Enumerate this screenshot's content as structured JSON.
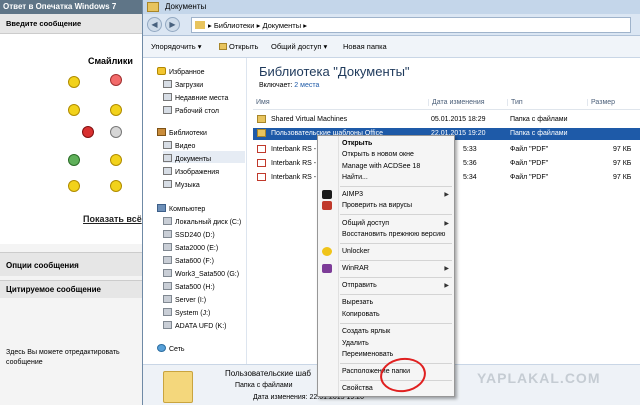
{
  "forum": {
    "header": "Ответ в Опечатка Windows 7",
    "enter_message": "Введите сообщение",
    "smileys_title": "Смайлики",
    "show_all": "Показать всё",
    "options_title": "Опции сообщения",
    "quoted_title": "Цитируемое сообщение",
    "edit_note": "Здесь Вы можете отредактировать сообщение"
  },
  "explorer": {
    "title": "Документы",
    "address": [
      "Библиотеки",
      "Документы"
    ],
    "toolbar": {
      "organize": "Упорядочить",
      "open": "Открыть",
      "share": "Общий доступ",
      "new_folder": "Новая папка"
    },
    "nav": {
      "favorites": "Избранное",
      "downloads": "Загрузки",
      "recent": "Недавние места",
      "desktop": "Рабочий стол",
      "libraries": "Библиотеки",
      "video": "Видео",
      "documents": "Документы",
      "pictures": "Изображения",
      "music": "Музыка",
      "computer": "Компьютер",
      "drives": [
        "Локальный диск (C:)",
        "SSD240 (D:)",
        "Sata2000 (E:)",
        "Sata600 (F:)",
        "Work3_Sata500 (G:)",
        "Sata500 (H:)",
        "Server (I:)",
        "System (J:)",
        "ADATA UFD (K:)"
      ],
      "network": "Сеть"
    },
    "library": {
      "title": "Библиотека \"Документы\"",
      "includes_label": "Включает:",
      "includes_value": "2 места"
    },
    "columns": {
      "name": "Имя",
      "date": "Дата изменения",
      "type": "Тип",
      "size": "Размер"
    },
    "files": [
      {
        "name": "Shared Virtual Machines",
        "date": "05.01.2015 18:29",
        "type": "Папка с файлами",
        "size": ""
      },
      {
        "name": "Пользовательские шаблоны Office",
        "date": "22.01.2015 19:20",
        "type": "Папка с файлами",
        "size": ""
      },
      {
        "name": "Interbank RS - ",
        "date": "5:33",
        "type": "Файл \"PDF\"",
        "size": "97 КБ"
      },
      {
        "name": "Interbank RS - ",
        "date": "5:36",
        "type": "Файл \"PDF\"",
        "size": "97 КБ"
      },
      {
        "name": "Interbank RS - ",
        "date": "5:34",
        "type": "Файл \"PDF\"",
        "size": "97 КБ"
      }
    ],
    "details": {
      "name": "Пользовательские шаб",
      "type": "Папка с файлами",
      "modified_label": "Дата изменения:",
      "modified_value": "22.01.2015 19:20"
    }
  },
  "context_menu": {
    "items": [
      "Открыть",
      "Открыть в новом окне",
      "Manage with ACDSee 18",
      "Найти...",
      "AIMP3",
      "Проверить на вирусы",
      "Общий доступ",
      "Восстановить прежнюю версию",
      "Unlocker",
      "WinRAR",
      "Отправить",
      "Вырезать",
      "Копировать",
      "Создать ярлык",
      "Удалить",
      "Переименовать",
      "Расположение папки",
      "Свойства"
    ]
  },
  "watermark": "YAPLAKAL.COM"
}
